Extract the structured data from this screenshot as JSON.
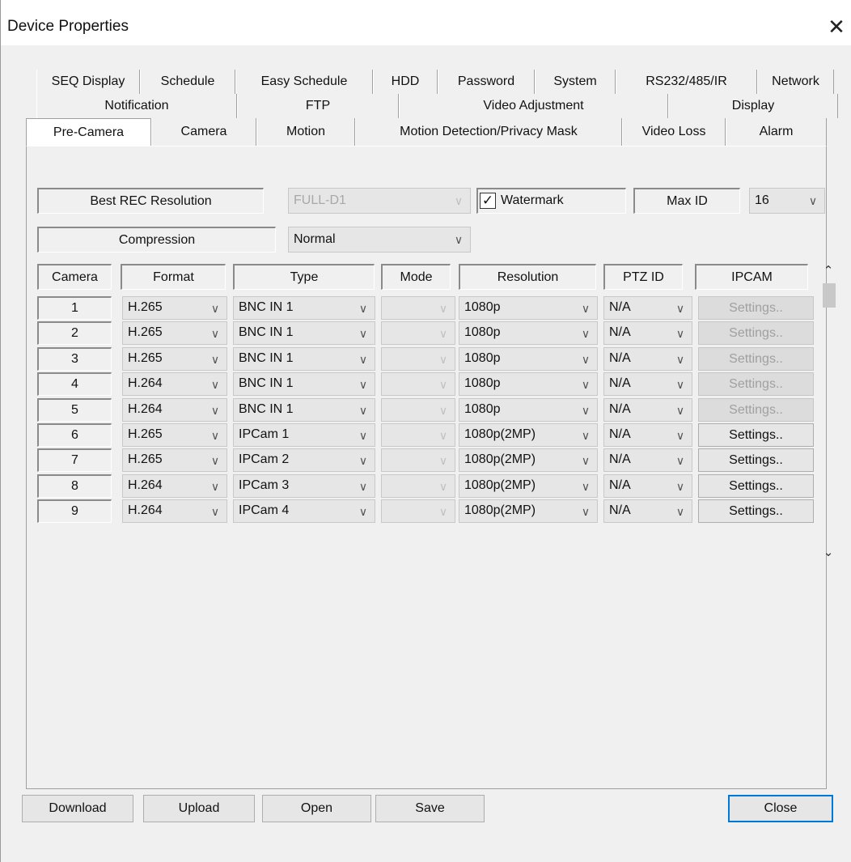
{
  "window": {
    "title": "Device Properties",
    "close_glyph": "✕"
  },
  "tabs": {
    "row1": [
      "SEQ Display",
      "Schedule",
      "Easy Schedule",
      "HDD",
      "Password",
      "System",
      "RS232/485/IR",
      "Network"
    ],
    "row2": [
      "Notification",
      "FTP",
      "Video Adjustment",
      "Display"
    ],
    "row3": [
      "Pre-Camera",
      "Camera",
      "Motion",
      "Motion Detection/Privacy Mask",
      "Video Loss",
      "Alarm"
    ],
    "active": "Pre-Camera"
  },
  "settings": {
    "best_rec_label": "Best REC Resolution",
    "best_rec_value": "FULL-D1",
    "watermark_label": "Watermark",
    "watermark_checked": true,
    "maxid_label": "Max ID",
    "maxid_value": "16",
    "compression_label": "Compression",
    "compression_value": "Normal"
  },
  "table": {
    "headers": [
      "Camera",
      "Format",
      "Type",
      "Mode",
      "Resolution",
      "PTZ ID",
      "IPCAM"
    ],
    "rows": [
      {
        "camera": "1",
        "format": "H.265",
        "type": "BNC IN 1",
        "resolution": "1080p",
        "ptz": "N/A",
        "ipcam": "Settings..",
        "ipcam_enabled": false
      },
      {
        "camera": "2",
        "format": "H.265",
        "type": "BNC IN 1",
        "resolution": "1080p",
        "ptz": "N/A",
        "ipcam": "Settings..",
        "ipcam_enabled": false
      },
      {
        "camera": "3",
        "format": "H.265",
        "type": "BNC IN 1",
        "resolution": "1080p",
        "ptz": "N/A",
        "ipcam": "Settings..",
        "ipcam_enabled": false
      },
      {
        "camera": "4",
        "format": "H.264",
        "type": "BNC IN 1",
        "resolution": "1080p",
        "ptz": "N/A",
        "ipcam": "Settings..",
        "ipcam_enabled": false
      },
      {
        "camera": "5",
        "format": "H.264",
        "type": "BNC IN 1",
        "resolution": "1080p",
        "ptz": "N/A",
        "ipcam": "Settings..",
        "ipcam_enabled": false
      },
      {
        "camera": "6",
        "format": "H.265",
        "type": "IPCam 1",
        "resolution": "1080p(2MP)",
        "ptz": "N/A",
        "ipcam": "Settings..",
        "ipcam_enabled": true
      },
      {
        "camera": "7",
        "format": "H.265",
        "type": "IPCam 2",
        "resolution": "1080p(2MP)",
        "ptz": "N/A",
        "ipcam": "Settings..",
        "ipcam_enabled": true
      },
      {
        "camera": "8",
        "format": "H.264",
        "type": "IPCam 3",
        "resolution": "1080p(2MP)",
        "ptz": "N/A",
        "ipcam": "Settings..",
        "ipcam_enabled": true
      },
      {
        "camera": "9",
        "format": "H.264",
        "type": "IPCam 4",
        "resolution": "1080p(2MP)",
        "ptz": "N/A",
        "ipcam": "Settings..",
        "ipcam_enabled": true
      }
    ]
  },
  "buttons": {
    "download": "Download",
    "upload": "Upload",
    "open": "Open",
    "save": "Save",
    "close": "Close"
  },
  "icons": {
    "dropdown": "chevron-down-icon",
    "scroll_up": "scroll-up-icon",
    "scroll_down": "scroll-down-icon",
    "check": "check-icon"
  }
}
